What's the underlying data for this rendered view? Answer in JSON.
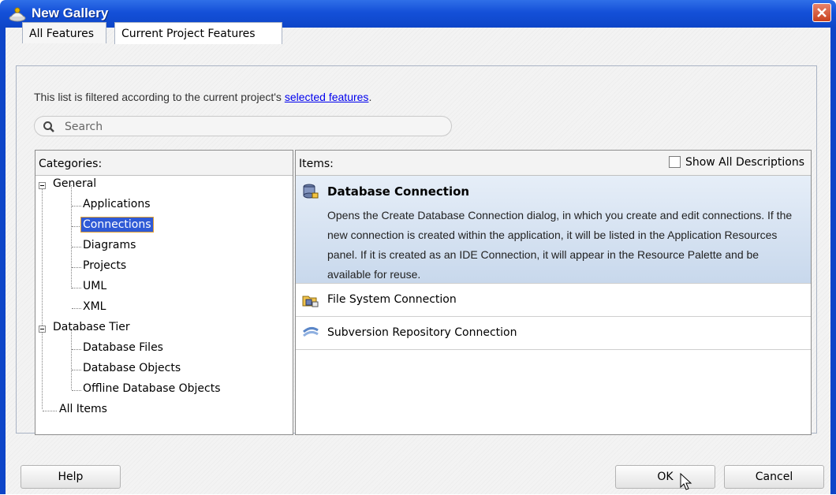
{
  "window": {
    "title": "New Gallery"
  },
  "tabs": [
    {
      "label": "All Features"
    },
    {
      "label": "Current Project Features"
    }
  ],
  "filter": {
    "text": "This list is filtered according to the current project's ",
    "link": "selected features",
    "suffix": "."
  },
  "search": {
    "placeholder": "Search"
  },
  "categories": {
    "header": "Categories:",
    "tree": [
      {
        "label": "General",
        "expanded": true
      },
      {
        "label": "Applications"
      },
      {
        "label": "Connections",
        "selected": true
      },
      {
        "label": "Diagrams"
      },
      {
        "label": "Projects"
      },
      {
        "label": "UML"
      },
      {
        "label": "XML"
      },
      {
        "label": "Database Tier",
        "expanded": true
      },
      {
        "label": "Database Files"
      },
      {
        "label": "Database Objects"
      },
      {
        "label": "Offline Database Objects"
      },
      {
        "label": "All Items"
      }
    ]
  },
  "items": {
    "header": "Items:",
    "show_all_label": "Show All Descriptions",
    "show_all_checked": false,
    "list": [
      {
        "title": "Database Connection",
        "icon": "database-connection-icon",
        "selected": true,
        "description": "Opens the Create Database Connection dialog, in which you create and edit connections. If the new connection is created within the application, it will be listed in the Application Resources panel. If it is created as an IDE Connection, it will appear in the Resource Palette and be available for reuse."
      },
      {
        "title": "File System Connection",
        "icon": "file-system-connection-icon"
      },
      {
        "title": "Subversion Repository Connection",
        "icon": "subversion-icon"
      }
    ]
  },
  "buttons": {
    "help": "Help",
    "ok": "OK",
    "cancel": "Cancel"
  },
  "colors": {
    "titlebar": "#1450d8",
    "selection": "#2f5ad6",
    "selected_item_bg": "#c8d8ec"
  }
}
